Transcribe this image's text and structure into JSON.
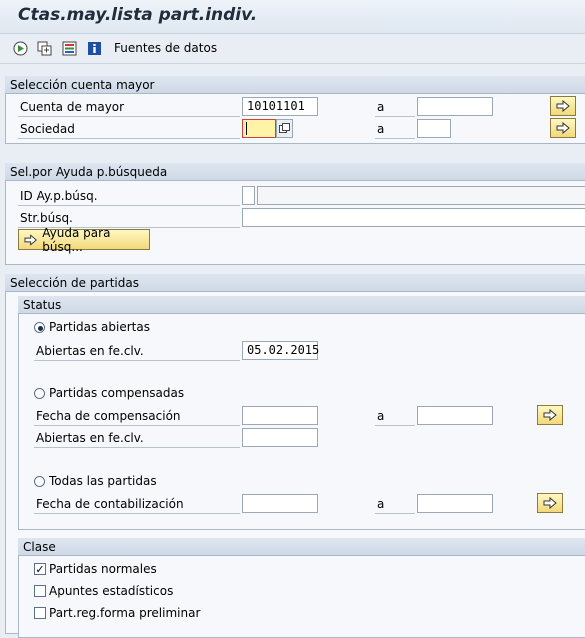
{
  "window": {
    "title": "Ctas.may.lista part.indiv."
  },
  "toolbar": {
    "data_sources_label": "Fuentes de datos"
  },
  "sel_cuenta": {
    "header": "Selección cuenta mayor",
    "cuenta_label": "Cuenta de mayor",
    "cuenta_value": "10101101",
    "a1": "a",
    "sociedad_label": "Sociedad",
    "a2": "a"
  },
  "sel_ayuda": {
    "header": "Sel.por Ayuda p.búsqueda",
    "id_label": "ID Ay.p.búsq.",
    "str_label": "Str.búsq.",
    "button_label": "Ayuda para búsq..."
  },
  "sel_partidas": {
    "header": "Selección de partidas",
    "status": {
      "header": "Status",
      "abiertas_radio": "Partidas abiertas",
      "abiertas_fecha_label": "Abiertas en fe.clv.",
      "abiertas_fecha_value": "05.02.2015",
      "compensadas_radio": "Partidas compensadas",
      "comp_fecha_label": "Fecha de compensación",
      "comp_a": "a",
      "comp_abiertas_label": "Abiertas en fe.clv.",
      "todas_radio": "Todas las partidas",
      "contab_label": "Fecha de contabilización",
      "contab_a": "a"
    },
    "clase": {
      "header": "Clase",
      "normales": "Partidas normales",
      "estadisticos": "Apuntes estadísticos",
      "preliminar": "Part.reg.forma preliminar",
      "normales_checked": "✓"
    }
  }
}
